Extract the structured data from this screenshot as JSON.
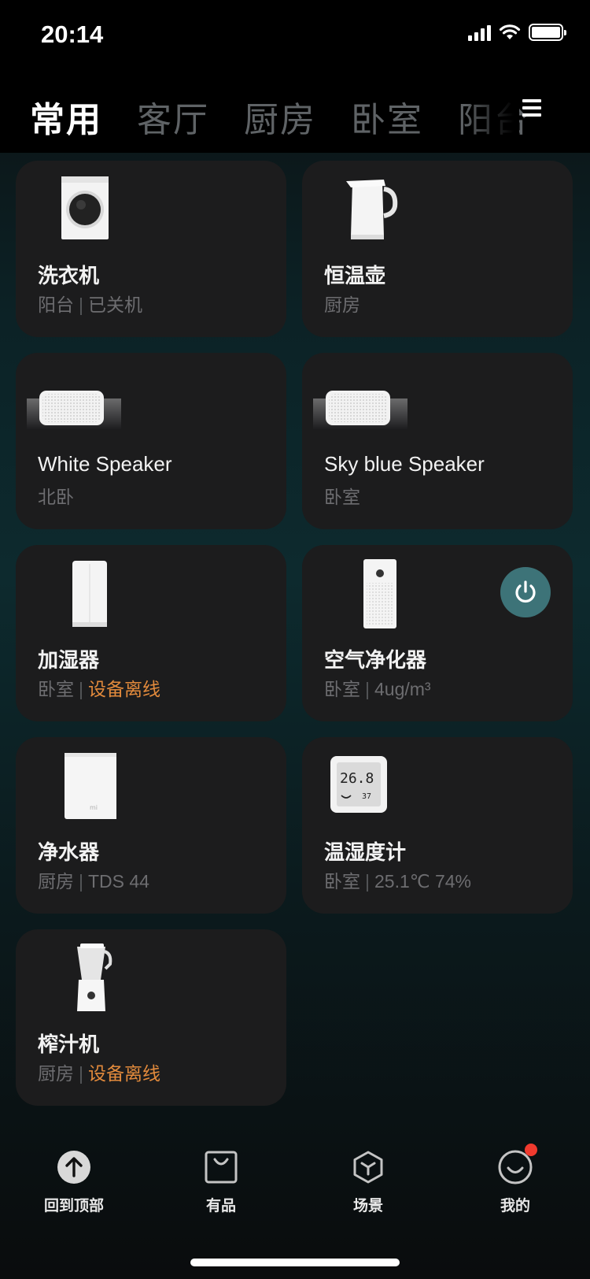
{
  "status_bar": {
    "time": "20:14"
  },
  "tabs": [
    {
      "label": "常用",
      "active": true
    },
    {
      "label": "客厅",
      "active": false
    },
    {
      "label": "厨房",
      "active": false
    },
    {
      "label": "卧室",
      "active": false
    },
    {
      "label": "阳台",
      "active": false
    }
  ],
  "devices": [
    {
      "name": "洗衣机",
      "room": "阳台",
      "status": "已关机",
      "status_color": "#6d6d70",
      "icon": "washing-machine-icon"
    },
    {
      "name": "恒温壶",
      "room": "厨房",
      "status": "",
      "icon": "kettle-icon"
    },
    {
      "name": "White Speaker",
      "room": "北卧",
      "status": "",
      "icon": "speaker-icon"
    },
    {
      "name": "Sky blue Speaker",
      "room": "卧室",
      "status": "",
      "icon": "speaker-icon"
    },
    {
      "name": "加湿器",
      "room": "卧室",
      "status": "设备离线",
      "status_color": "#e28a3c",
      "icon": "humidifier-icon"
    },
    {
      "name": "空气净化器",
      "room": "卧室",
      "status": "4ug/m³",
      "status_color": "#6d6d70",
      "icon": "air-purifier-icon",
      "power_on": true
    },
    {
      "name": "净水器",
      "room": "厨房",
      "status": "TDS 44",
      "status_color": "#6d6d70",
      "icon": "water-purifier-icon"
    },
    {
      "name": "温湿度计",
      "room": "卧室",
      "status": "25.1℃ 74%",
      "status_color": "#6d6d70",
      "icon": "thermo-hygrometer-icon"
    },
    {
      "name": "榨汁机",
      "room": "厨房",
      "status": "设备离线",
      "status_color": "#e28a3c",
      "icon": "blender-icon"
    }
  ],
  "thermometer_display": {
    "temp": "26.8",
    "humidity": "37"
  },
  "bottom_nav": [
    {
      "label": "回到顶部",
      "icon": "arrow-up-circle-icon"
    },
    {
      "label": "有品",
      "icon": "shopping-bag-icon"
    },
    {
      "label": "场景",
      "icon": "cube-icon"
    },
    {
      "label": "我的",
      "icon": "smile-face-icon",
      "badge": true
    }
  ],
  "colors": {
    "accent_power": "#3d7378",
    "warn": "#e28a3c",
    "card_bg": "#1c1c1d",
    "badge": "#f03a2e"
  }
}
